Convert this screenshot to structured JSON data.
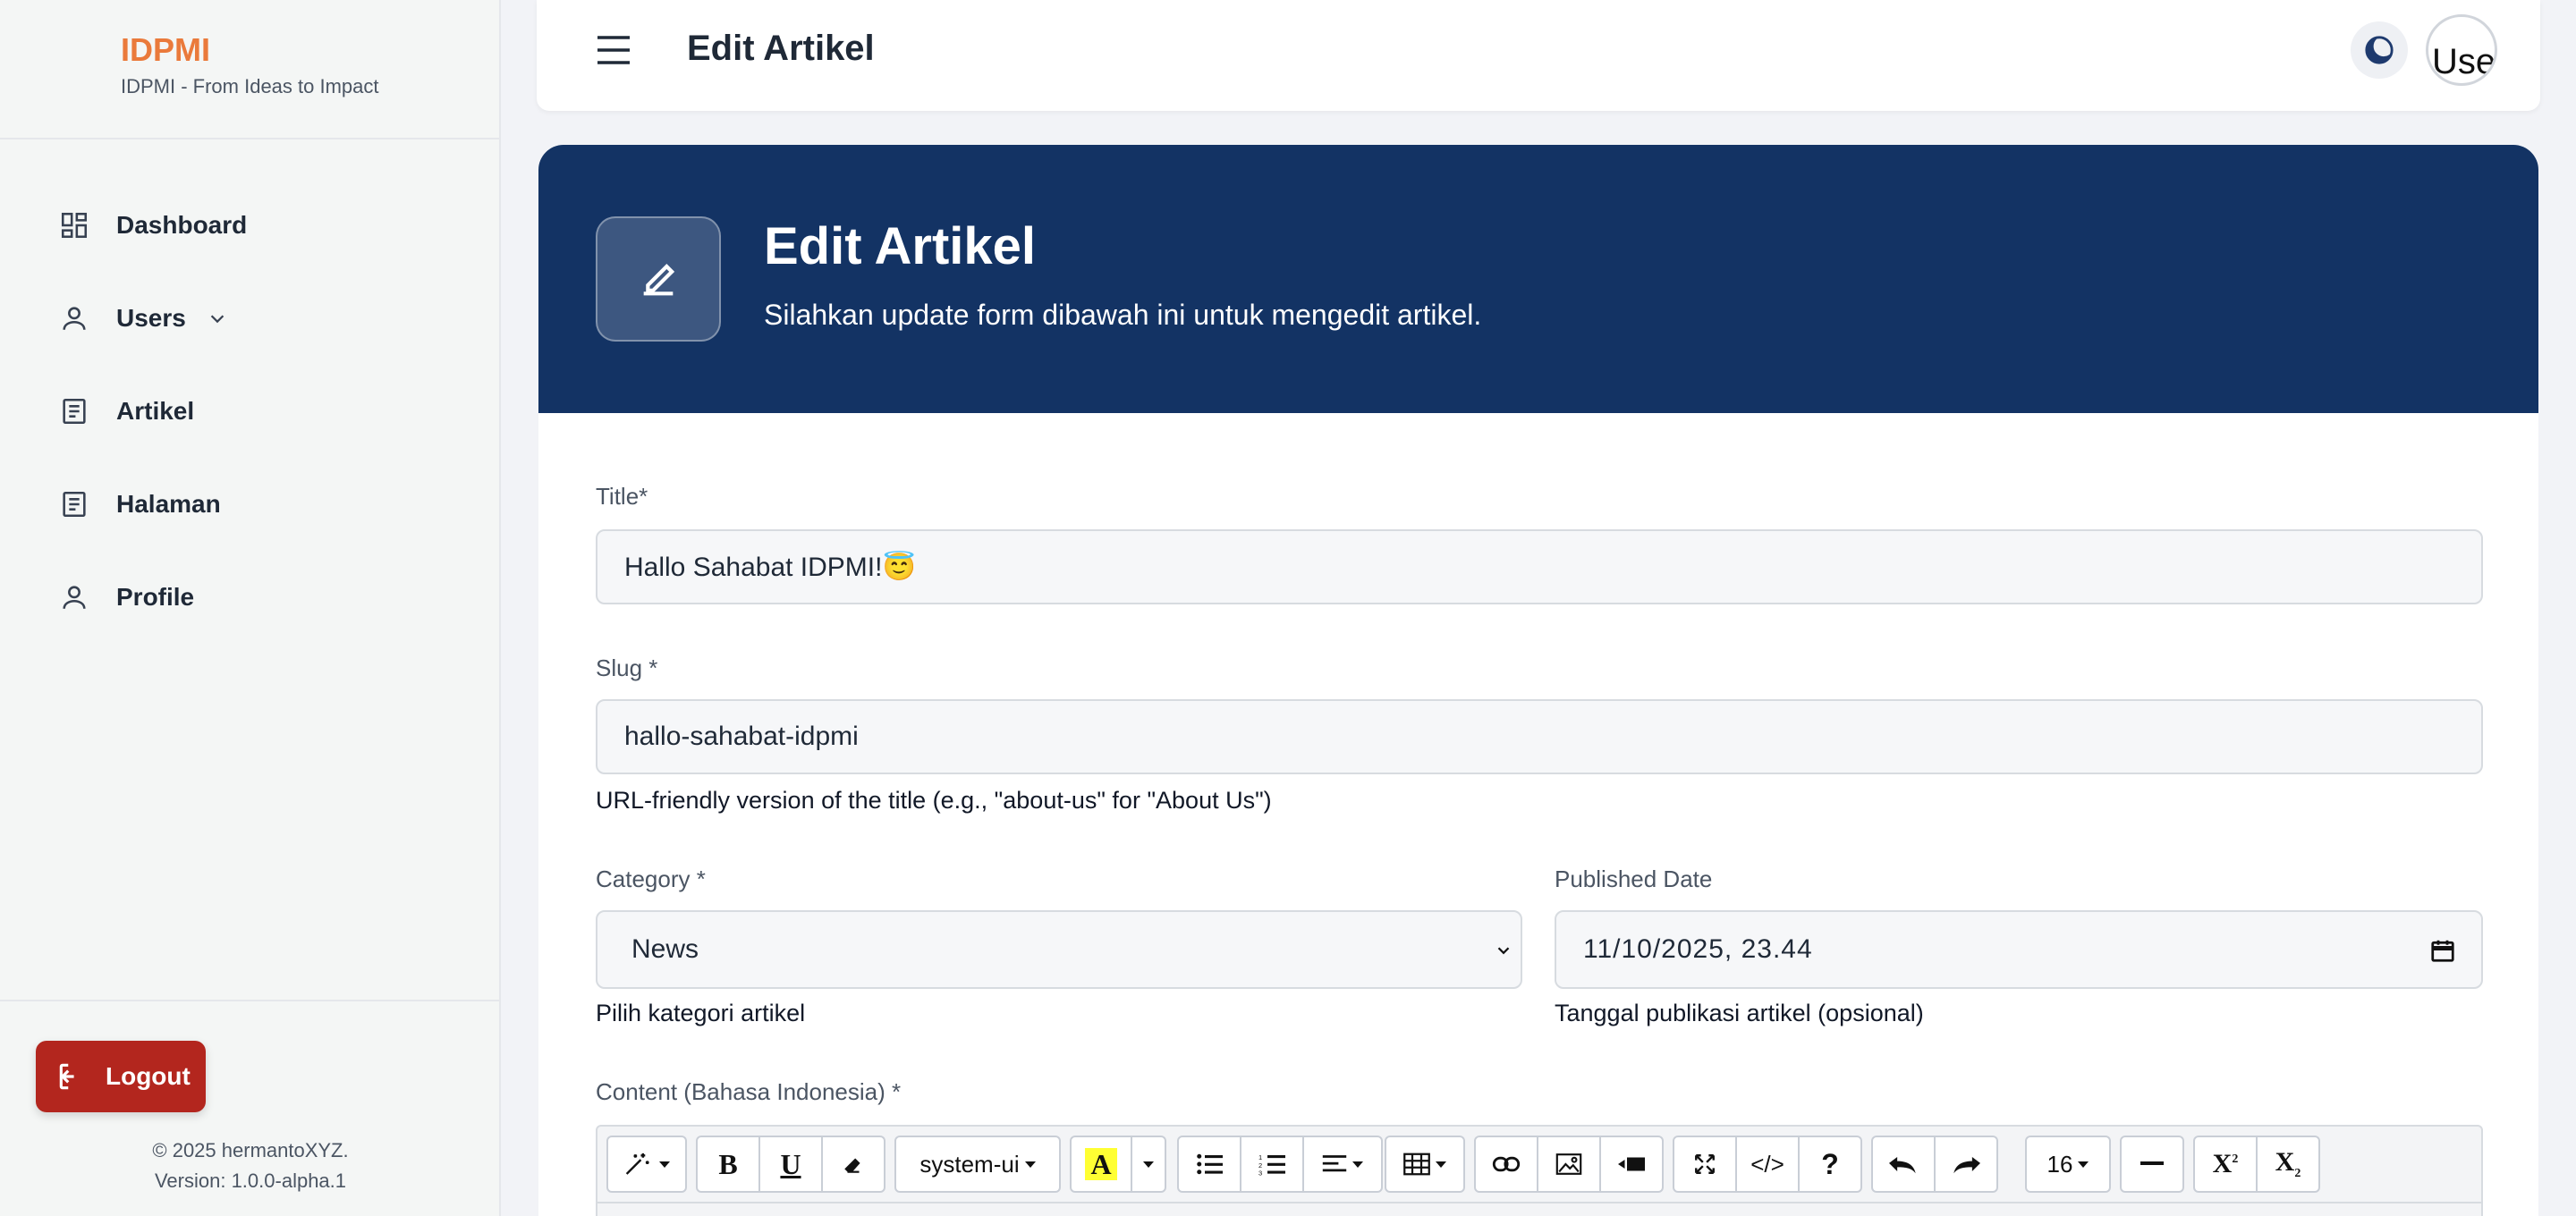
{
  "brand": {
    "name": "IDPMI",
    "tagline": "IDPMI - From Ideas to Impact"
  },
  "sidebar": {
    "items": [
      {
        "label": "Dashboard",
        "icon": "dashboard-icon"
      },
      {
        "label": "Users",
        "icon": "user-icon",
        "has_submenu": true
      },
      {
        "label": "Artikel",
        "icon": "document-icon"
      },
      {
        "label": "Halaman",
        "icon": "document-icon"
      },
      {
        "label": "Profile",
        "icon": "user-icon"
      }
    ],
    "logout_label": "Logout",
    "copyright": "© 2025 hermantoXYZ.",
    "version": "Version: 1.0.0-alpha.1"
  },
  "header": {
    "title": "Edit Artikel",
    "avatar_alt": "Use"
  },
  "hero": {
    "title": "Edit Artikel",
    "subtitle": "Silahkan update form dibawah ini untuk mengedit artikel."
  },
  "form": {
    "title_label": "Title*",
    "title_value": "Hallo Sahabat IDPMI!😇",
    "slug_label": "Slug *",
    "slug_value": "hallo-sahabat-idpmi",
    "slug_hint": "URL-friendly version of the title (e.g., \"about-us\" for \"About Us\")",
    "category_label": "Category *",
    "category_value": "News",
    "category_hint": "Pilih kategori artikel",
    "date_label": "Published Date",
    "date_value": "11/10/2025, 23.44",
    "date_hint": "Tanggal publikasi artikel (opsional)",
    "content_label": "Content (Bahasa Indonesia) *"
  },
  "editor": {
    "font_family": "system-ui",
    "font_size": "16",
    "tools": [
      "magic-icon",
      "bold-icon",
      "underline-icon",
      "eraser-icon",
      "font-family-select",
      "highlight-icon",
      "bullet-list-icon",
      "numbered-list-icon",
      "align-icon",
      "table-icon",
      "link-icon",
      "image-icon",
      "video-icon",
      "fullscreen-icon",
      "code-view-icon",
      "help-icon",
      "undo-icon",
      "redo-icon",
      "font-size-select",
      "horizontal-rule-icon",
      "superscript-icon",
      "subscript-icon"
    ]
  },
  "colors": {
    "brand": "#ea7a3b",
    "hero": "#133364",
    "logout": "#b3261e"
  }
}
